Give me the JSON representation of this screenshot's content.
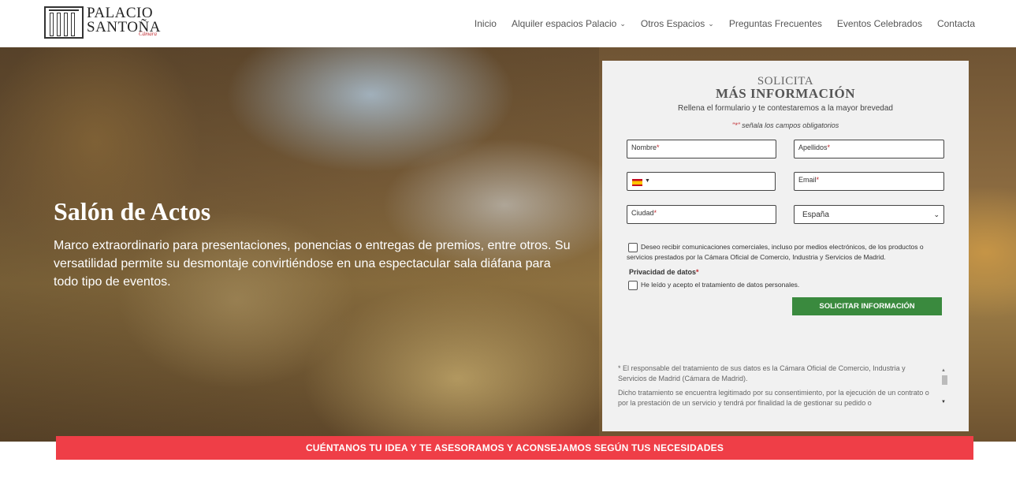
{
  "header": {
    "logo_line1": "PALACIO",
    "logo_line2": "SANTOÑA",
    "logo_sub": "Cámara"
  },
  "nav": {
    "items": [
      {
        "label": "Inicio",
        "has_dropdown": false
      },
      {
        "label": "Alquiler espacios Palacio",
        "has_dropdown": true
      },
      {
        "label": "Otros Espacios",
        "has_dropdown": true
      },
      {
        "label": "Preguntas Frecuentes",
        "has_dropdown": false
      },
      {
        "label": "Eventos Celebrados",
        "has_dropdown": false
      },
      {
        "label": "Contacta",
        "has_dropdown": false
      }
    ]
  },
  "hero": {
    "title": "Salón de Actos",
    "text": "Marco extraordinario para presentaciones, ponencias o entregas de premios, entre otros. Su versatilidad permite su desmontaje convirtiéndose en una espectacular sala diáfana para todo tipo de eventos."
  },
  "form": {
    "title_line1": "SOLICITA",
    "title_line2": "MÁS INFORMACIÓN",
    "subtitle": "Rellena el formulario y te contestaremos a la mayor brevedad",
    "required_marker": "\"*\"",
    "required_note": " señala los campos obligatorios",
    "fields": {
      "nombre": "Nombre",
      "apellidos": "Apellidos",
      "email": "Email",
      "ciudad": "Ciudad",
      "country_selected": "España"
    },
    "consent_marketing": "Deseo recibir comunicaciones comerciales, incluso por medios electrónicos, de los productos o servicios prestados por la Cámara Oficial de Comercio, Industria y Servicios de Madrid.",
    "privacy_label": "Privacidad de datos",
    "privacy_check": "He leído y acepto el tratamiento de datos personales.",
    "submit_label": "SOLICITAR INFORMACIÓN",
    "legal_p1": "*  El  responsable del tratamiento de sus datos es la Cámara Oficial de Comercio, Industria y Servicios de Madrid (Cámara de Madrid).",
    "legal_p2": "Dicho tratamiento se encuentra legitimado por su consentimiento, por la ejecución de un contrato o por la prestación de un servicio y  tendrá por finalidad la de gestionar su pedido o"
  },
  "banner": {
    "text": "CUÉNTANOS TU IDEA Y TE ASESORAMOS Y ACONSEJAMOS SEGÚN TUS NECESIDADES"
  }
}
